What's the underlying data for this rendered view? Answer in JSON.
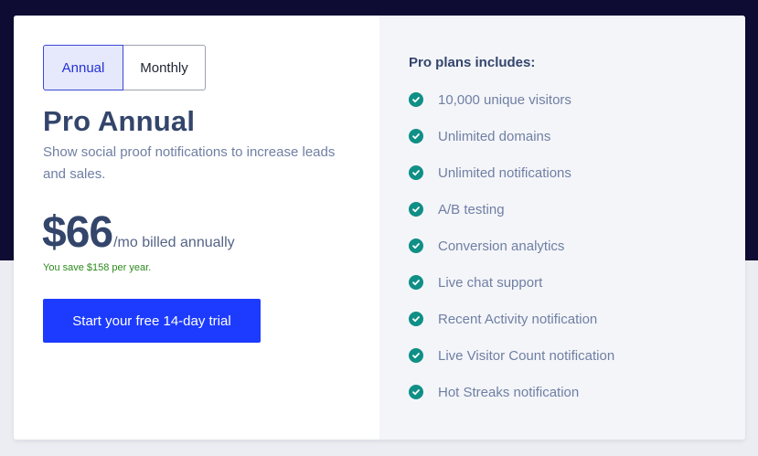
{
  "toggle": {
    "annual_label": "Annual",
    "monthly_label": "Monthly",
    "selected": "Annual"
  },
  "plan": {
    "title": "Pro Annual",
    "description": "Show social proof notifications to increase leads and sales.",
    "price": "$66",
    "price_suffix": "/mo billed annually",
    "savings": "You save $158 per year.",
    "cta_label": "Start your free 14-day trial"
  },
  "includes": {
    "title": "Pro plans includes:",
    "icon": "check-circle-icon",
    "items": [
      "10,000 unique visitors",
      "Unlimited domains",
      "Unlimited notifications",
      "A/B testing",
      "Conversion analytics",
      "Live chat support",
      "Recent Activity notification",
      "Live Visitor Count notification",
      "Hot Streaks notification"
    ]
  },
  "colors": {
    "background_top": "#0f0c33",
    "background_bottom": "#ebedf2",
    "accent": "#1c3bff",
    "heading": "#33456b",
    "body_text": "#6f7fa3",
    "check": "#0f8f86",
    "savings": "#2b8a1b"
  }
}
